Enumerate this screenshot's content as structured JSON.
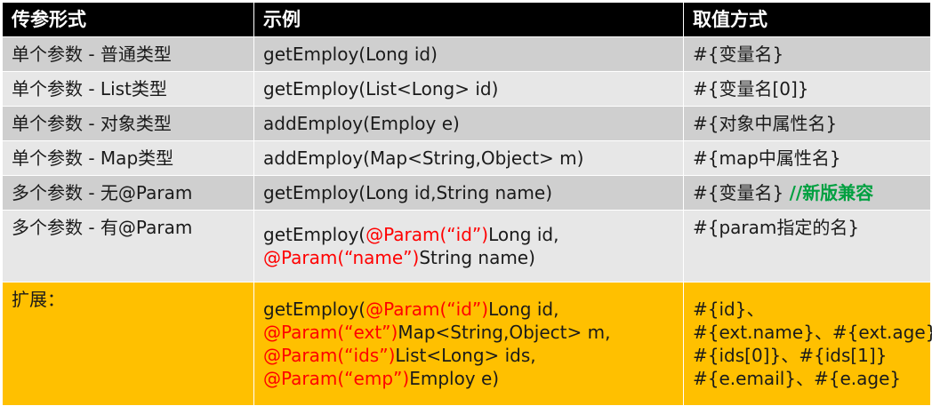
{
  "header": [
    "传参形式",
    "示例",
    "取值方式"
  ],
  "rows": [
    {
      "label": "单个参数 - 普通类型",
      "example": [
        [
          {
            "t": "getEmploy(Long id)",
            "c": "normal"
          }
        ]
      ],
      "value": [
        [
          {
            "t": "#{变量名}",
            "c": "normal"
          }
        ]
      ]
    },
    {
      "label": "单个参数 - List类型",
      "example": [
        [
          {
            "t": "getEmploy(List<Long> id)",
            "c": "normal"
          }
        ]
      ],
      "value": [
        [
          {
            "t": "#{变量名[0]}",
            "c": "normal"
          }
        ]
      ]
    },
    {
      "label": "单个参数 - 对象类型",
      "example": [
        [
          {
            "t": "addEmploy(Employ e)",
            "c": "normal"
          }
        ]
      ],
      "value": [
        [
          {
            "t": "#{对象中属性名}",
            "c": "normal"
          }
        ]
      ]
    },
    {
      "label": "单个参数 - Map类型",
      "example": [
        [
          {
            "t": "addEmploy(Map<String,Object> m)",
            "c": "normal"
          }
        ]
      ],
      "value": [
        [
          {
            "t": "#{map中属性名}",
            "c": "normal"
          }
        ]
      ]
    },
    {
      "label": "多个参数 - 无@Param",
      "example": [
        [
          {
            "t": "getEmploy(Long id,String name)",
            "c": "normal"
          }
        ]
      ],
      "value": [
        [
          {
            "t": "#{变量名} ",
            "c": "normal"
          },
          {
            "t": "//新版兼容",
            "c": "green"
          }
        ]
      ]
    },
    {
      "label": "多个参数 - 有@Param",
      "example": [
        [
          {
            "t": "getEmploy(",
            "c": "normal"
          },
          {
            "t": "@Param(“id”)",
            "c": "red"
          },
          {
            "t": "Long id,",
            "c": "normal"
          }
        ],
        [
          {
            "t": "@Param(“name”)",
            "c": "red"
          },
          {
            "t": "String name)",
            "c": "normal"
          }
        ]
      ],
      "value": [
        [
          {
            "t": "#{param指定的名}",
            "c": "normal"
          }
        ]
      ]
    },
    {
      "label": "扩展：",
      "example": [
        [
          {
            "t": "getEmploy(",
            "c": "normal"
          },
          {
            "t": "@Param(“id”)",
            "c": "red"
          },
          {
            "t": "Long id,",
            "c": "normal"
          }
        ],
        [
          {
            "t": "@Param(“ext”)",
            "c": "red"
          },
          {
            "t": "Map<String,Object> m,",
            "c": "normal"
          }
        ],
        [
          {
            "t": "@Param(“ids”)",
            "c": "red"
          },
          {
            "t": "List<Long> ids,",
            "c": "normal"
          }
        ],
        [
          {
            "t": "@Param(“emp”)",
            "c": "red"
          },
          {
            "t": "Employ e)",
            "c": "normal"
          }
        ]
      ],
      "value": [
        [
          {
            "t": "#{id}、",
            "c": "normal"
          }
        ],
        [
          {
            "t": "#{ext.name}、#{ext.age}",
            "c": "normal"
          }
        ],
        [
          {
            "t": "#{ids[0]}、#{ids[1]}",
            "c": "normal"
          }
        ],
        [
          {
            "t": "#{e.email}、#{e.age}",
            "c": "normal"
          }
        ]
      ]
    }
  ],
  "colors": {
    "header_bg": "#000000",
    "row_dark": "#cfcfcf",
    "row_light": "#e7e7e7",
    "ext_bg": "#ffc000",
    "highlight_red": "#ff0000",
    "comment_green": "#00a040"
  }
}
